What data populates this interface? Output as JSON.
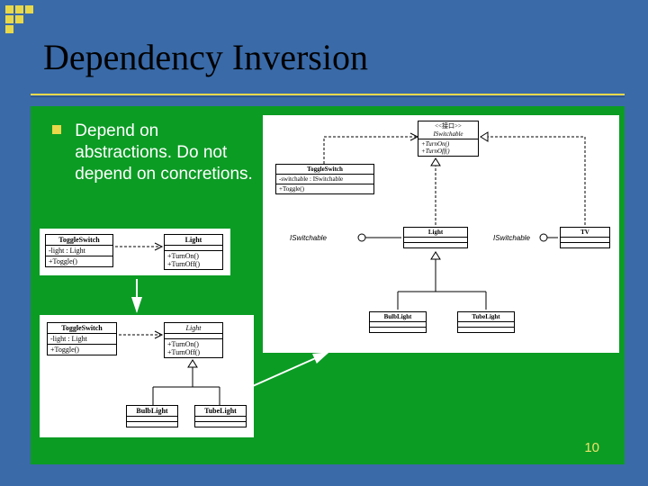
{
  "decoration": {
    "icon": "corner-squares-pattern"
  },
  "title": "Dependency Inversion",
  "bullets": [
    "Depend on abstractions. Do not depend on concretions."
  ],
  "page_number": "10",
  "diagrams": {
    "small_top": {
      "toggle_switch": {
        "name": "ToggleSwitch",
        "attr": "-light : Light",
        "op": "+Toggle()"
      },
      "light": {
        "name": "Light",
        "ops": [
          "+TurnOn()",
          "+TurnOff()"
        ]
      }
    },
    "small_bottom": {
      "toggle_switch": {
        "name": "ToggleSwitch",
        "attr": "-light : Light",
        "op": "+Toggle()"
      },
      "light": {
        "name": "Light",
        "ops": [
          "+TurnOn()",
          "+TurnOff()"
        ]
      },
      "bulb": {
        "name": "BulbLight"
      },
      "tube": {
        "name": "TubeLight"
      }
    },
    "large_right": {
      "iswitchable": {
        "stereotype": "<<接口>>",
        "name": "ISwitchable",
        "ops": [
          "+TurnOn()",
          "+TurnOff()"
        ]
      },
      "toggle_switch": {
        "name": "ToggleSwitch",
        "attr": "-switchable : ISwitchable",
        "op": "+Toggle()"
      },
      "light": {
        "name": "Light",
        "note": "ISwitchable"
      },
      "tv": {
        "name": "TV",
        "note": "ISwitchable"
      },
      "bulb": {
        "name": "BulbLight"
      },
      "tube": {
        "name": "TubeLight"
      }
    }
  }
}
